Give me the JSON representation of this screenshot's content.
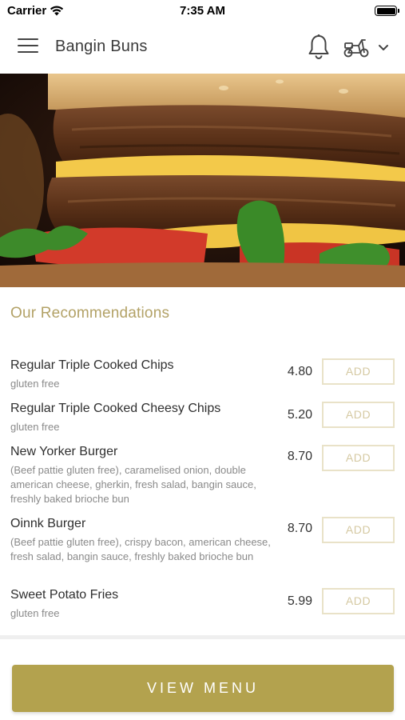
{
  "status_bar": {
    "carrier": "Carrier",
    "time": "7:35 AM",
    "icons": [
      "wifi-icon",
      "battery-icon"
    ]
  },
  "header": {
    "title": "Bangin Buns",
    "icons": [
      "hamburger-menu-icon",
      "bell-icon",
      "scooter-icon",
      "chevron-down-icon"
    ]
  },
  "hero": {
    "image": "burger-photo"
  },
  "recommendations": {
    "title": "Our Recommendations",
    "add_label": "ADD",
    "items": [
      {
        "name": "Regular Triple Cooked Chips",
        "desc": "gluten free",
        "price": "4.80"
      },
      {
        "name": "Regular Triple Cooked Cheesy Chips",
        "desc": "gluten free",
        "price": "5.20"
      },
      {
        "name": "New Yorker Burger",
        "desc": "(Beef pattie gluten free), caramelised onion, double american cheese, gherkin, fresh salad, bangin sauce, freshly baked brioche bun",
        "price": "8.70"
      },
      {
        "name": "Oinnk Burger",
        "desc": "(Beef pattie gluten free), crispy bacon, american cheese, fresh salad, bangin sauce, freshly baked brioche bun",
        "price": "8.70"
      },
      {
        "name": "Sweet Potato Fries",
        "desc": "gluten free",
        "price": "5.99"
      }
    ]
  },
  "footer": {
    "view_menu_label": "VIEW MENU"
  },
  "colors": {
    "accent": "#b3a24e",
    "section_title": "#b3a267",
    "add_border": "#e9e2c8",
    "add_text": "#d5c9a2"
  }
}
